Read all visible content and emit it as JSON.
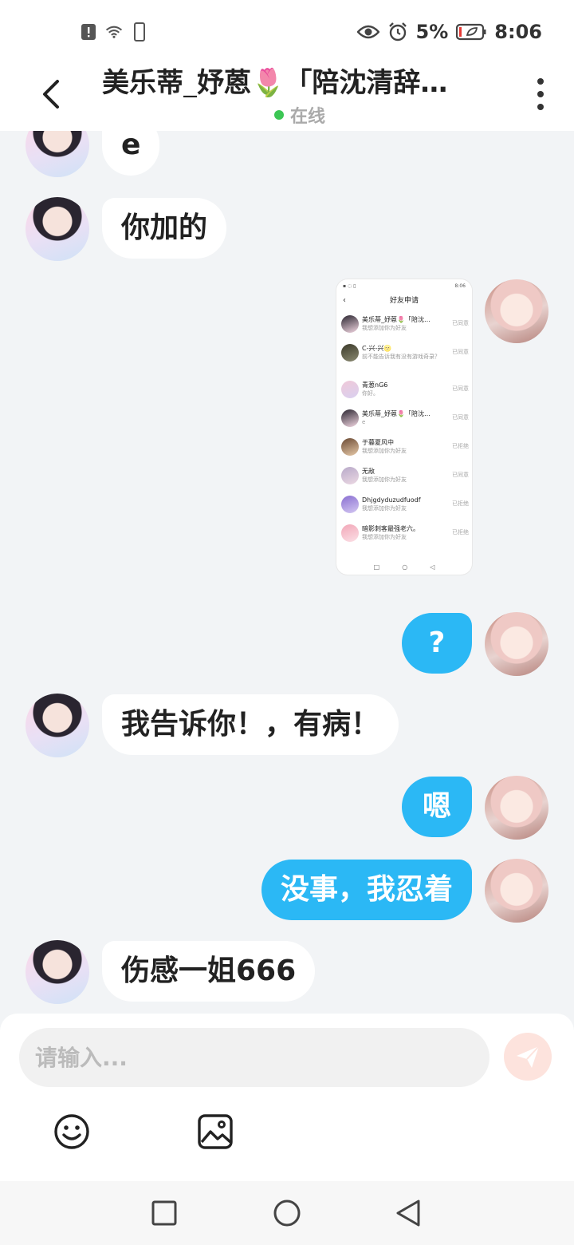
{
  "status_bar": {
    "battery": "5%",
    "time": "8:06"
  },
  "header": {
    "title": "美乐蒂_妤蒽🌷「陪沈清辞…",
    "status": "在线"
  },
  "messages": [
    {
      "side": "other",
      "text": "e"
    },
    {
      "side": "other",
      "text": "你加的"
    },
    {
      "side": "self",
      "text": "?"
    },
    {
      "side": "other",
      "text": "我告诉你！，有病！"
    },
    {
      "side": "self",
      "text": "嗯"
    },
    {
      "side": "self",
      "text": "没事，我忍着"
    },
    {
      "side": "other",
      "text": "伤感一姐666"
    }
  ],
  "screenshot_message": {
    "time": "8:06",
    "title": "好友申请",
    "rows": [
      {
        "name": "美乐蒂_妤蒽🌷「陪沈…",
        "sub": "我想添加你为好友",
        "status": "已同意"
      },
      {
        "name": "C-兴-兴🌝",
        "sub": "前不能告诉我有没有游戏奇录？",
        "status": "已同意"
      },
      {
        "name": "青葱nG6",
        "sub": "你好。",
        "status": "已同意"
      },
      {
        "name": "美乐蒂_妤蒽🌷「陪沈…",
        "sub": "e",
        "status": "已同意"
      },
      {
        "name": "于暮夏风中",
        "sub": "我想添加你为好友",
        "status": "已拒绝"
      },
      {
        "name": "无敌",
        "sub": "我想添加你为好友",
        "status": "已同意"
      },
      {
        "name": "Dhjgdyduzudfuodf",
        "sub": "我想添加你为好友",
        "status": "已拒绝"
      },
      {
        "name": "暗影刺客最强老六。",
        "sub": "我想添加你为好友",
        "status": "已拒绝"
      }
    ]
  },
  "input": {
    "placeholder": "请输入..."
  },
  "colors": {
    "self_bubble": "#2bb8f5",
    "other_bubble": "#ffffff",
    "background": "#f2f4f6",
    "online": "#3cc654",
    "send_button": "#fde3dd"
  },
  "icons": {
    "back": "chevron-left-icon",
    "more": "more-vertical-icon",
    "send": "paper-plane-icon",
    "emoji": "smiley-icon",
    "image": "image-icon"
  }
}
